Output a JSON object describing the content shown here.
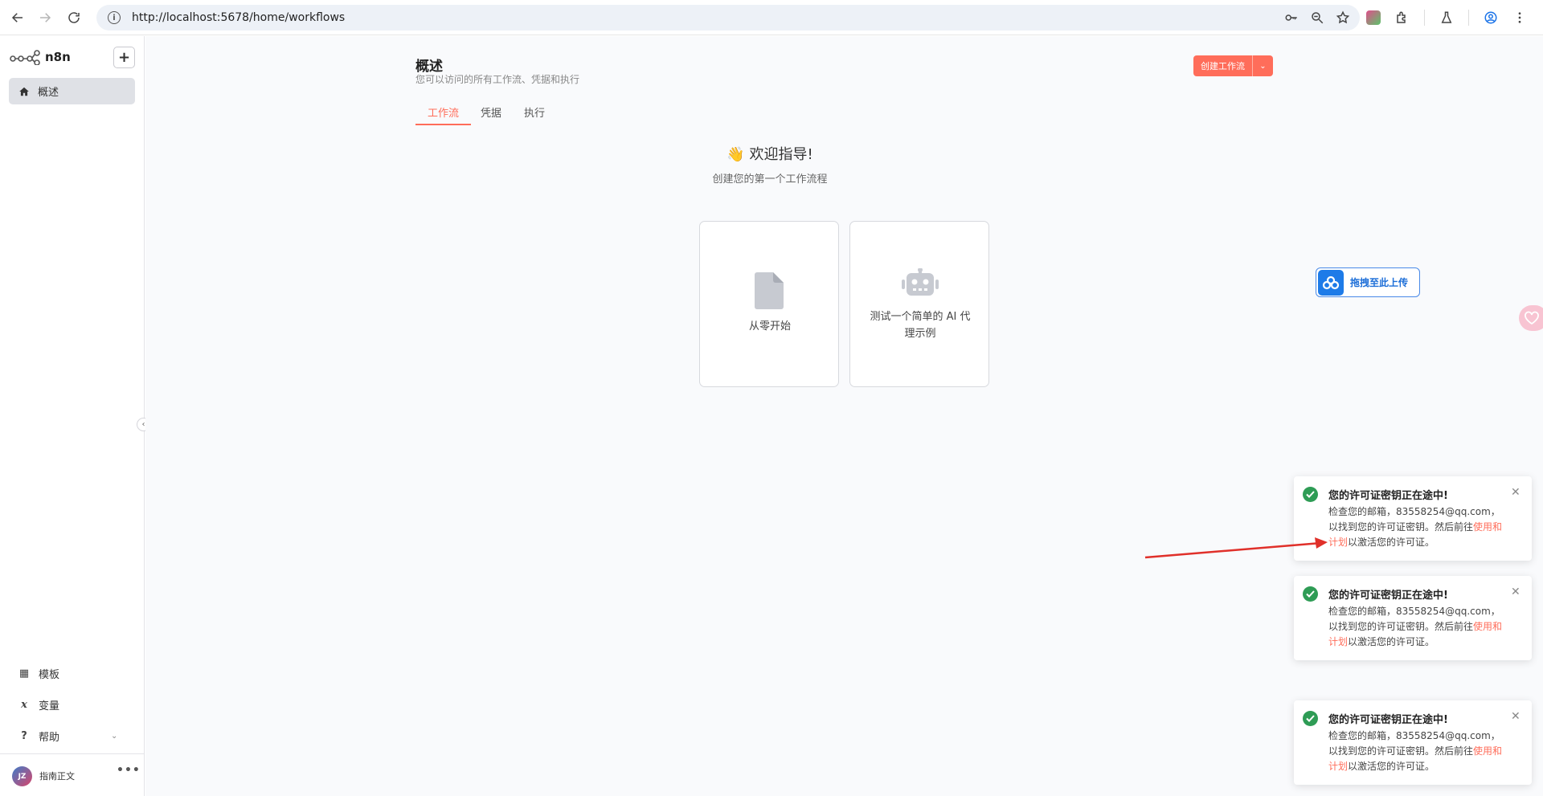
{
  "browser": {
    "url": "http://localhost:5678/home/workflows"
  },
  "sidebar": {
    "app_name": "n8n",
    "add_label": "+",
    "nav_active": "概述",
    "bottom_items": [
      {
        "label": "模板",
        "icon": "template-icon"
      },
      {
        "label": "变量",
        "icon": "variable-icon"
      },
      {
        "label": "帮助",
        "icon": "help-icon"
      }
    ],
    "user": {
      "initials": "JZ",
      "name": "指南正文"
    },
    "more": "•••"
  },
  "header": {
    "title": "概述",
    "subtitle": "您可以访问的所有工作流、凭据和执行",
    "create_button": "创建工作流"
  },
  "tabs": [
    {
      "label": "工作流",
      "active": true
    },
    {
      "label": "凭据",
      "active": false
    },
    {
      "label": "执行",
      "active": false
    }
  ],
  "empty_state": {
    "emoji": "👋",
    "title": "欢迎指导!",
    "subtitle": "创建您的第一个工作流程",
    "cards": [
      {
        "label": "从零开始",
        "icon": "file-icon"
      },
      {
        "label": "测试一个简单的 AI 代理示例",
        "icon": "robot-icon"
      }
    ]
  },
  "upload": {
    "label": "拖拽至此上传"
  },
  "toasts": [
    {
      "title": "您的许可证密钥正在途中!",
      "body_pre": "检查您的邮箱，83558254@qq.com，以找到您的许可证密钥。然后前往",
      "link": "使用和计划",
      "body_post": "以激活您的许可证。"
    },
    {
      "title": "您的许可证密钥正在途中!",
      "body_pre": "检查您的邮箱，83558254@qq.com，以找到您的许可证密钥。然后前往",
      "link": "使用和计划",
      "body_post": "以激活您的许可证。"
    },
    {
      "title": "您的许可证密钥正在途中!",
      "body_pre": "检查您的邮箱，83558254@qq.com，以找到您的许可证密钥。然后前往",
      "link": "使用和计划",
      "body_post": "以激活您的许可证。"
    }
  ],
  "colors": {
    "accent": "#ff6d5a",
    "success": "#2e9c55",
    "annotation_arrow": "#e0302a"
  }
}
